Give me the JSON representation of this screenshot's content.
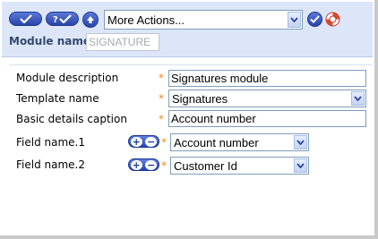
{
  "toolbar": {
    "action_select": "More Actions...",
    "module_name_label": "Module name",
    "module_name_value": "SIGNATURE"
  },
  "form": {
    "module_description_label": "Module description",
    "module_description_value": "Signatures module",
    "template_name_label": "Template name",
    "template_name_value": "Signatures",
    "basic_details_caption_label": "Basic details caption",
    "basic_details_caption_value": "Account number",
    "field1_label": "Field name.1",
    "field1_value": "Account number",
    "field2_label": "Field name.2",
    "field2_value": "Customer Id",
    "required_marker": "*",
    "plus_symbol": "+",
    "minus_symbol": "−"
  },
  "icons": {
    "confirm": "checkmark-icon",
    "confirm_query": "question-check-icon",
    "upload": "up-arrow-icon",
    "go": "go-check-icon",
    "help": "lifebuoy-icon",
    "dropdown": "chevron-down-icon"
  },
  "colors": {
    "toolbar_bg": "#dce6f8",
    "button_blue": "#2a44a8",
    "required_star": "#f08a10",
    "label_blue": "#34496f"
  }
}
